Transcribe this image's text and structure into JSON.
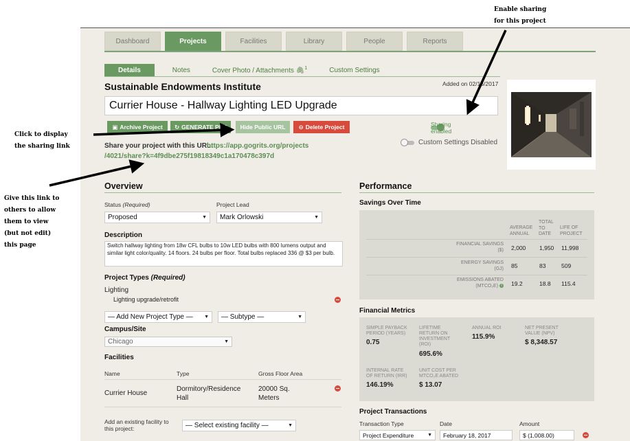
{
  "annotations": {
    "enable_sharing": [
      "Enable sharing",
      "for this project"
    ],
    "click_to_display": [
      "Click to display",
      "the sharing link"
    ],
    "give_link": [
      "Give this link to",
      "others to allow",
      "them to view",
      "(but not edit)",
      "this page"
    ]
  },
  "nav": {
    "tabs": [
      "Dashboard",
      "Projects",
      "Facilities",
      "Library",
      "People",
      "Reports"
    ],
    "active": "Projects"
  },
  "subtabs": {
    "details": "Details",
    "notes": "Notes",
    "cover": "Cover Photo / Attachments",
    "cover_count": "1",
    "custom": "Custom Settings"
  },
  "project": {
    "added": "Added on 02/16/2017",
    "organization": "Sustainable Endowments Institute",
    "title": "Currier House - Hallway Lighting LED Upgrade"
  },
  "buttons": {
    "archive": "Archive Project",
    "generate": "GENERATE PDF",
    "hide_url": "Hide Public URL",
    "delete": "Delete Project"
  },
  "toggles": {
    "sharing": "Sharing enabled",
    "sharing_on": true,
    "custom": "Custom Settings Disabled",
    "custom_on": false
  },
  "share": {
    "label": "Share your project with this URL:",
    "url_part1": "https://app.gogrits.org/projects",
    "url_part2": "/4021/share?k=4f9dbe275f19818349c1a170478c397d"
  },
  "overview": {
    "heading": "Overview",
    "status_label": "Status",
    "required": "(Required)",
    "status_value": "Proposed",
    "lead_label": "Project Lead",
    "lead_value": "Mark Orlowski",
    "description_label": "Description",
    "description": "Switch hallway lighting from 18w CFL bulbs to 10w LED bulbs with 800 lumens output and similar light color/quality. 14 floors. 24 bulbs per floor. Total bulbs replaced 336 @ $3 per bulb.",
    "types_label": "Project Types",
    "types_required": "(Required)",
    "type_name": "Lighting",
    "type_sub": "Lighting upgrade/retrofit",
    "add_type": "— Add New Project Type —",
    "subtype": "— Subtype —",
    "campus_label": "Campus/Site",
    "campus_value": "Chicago",
    "facilities_label": "Facilities",
    "fac_headers": [
      "Name",
      "Type",
      "Gross Floor Area"
    ],
    "fac_row": {
      "name": "Currier House",
      "type": [
        "Dormitory/Residence",
        "Hall"
      ],
      "area": [
        "20000 Sq.",
        "Meters"
      ]
    },
    "existing_label": [
      "Add an existing facility to",
      "this project:"
    ],
    "existing_select": "— Select existing facility —"
  },
  "performance": {
    "heading": "Performance",
    "savings_heading": "Savings Over Time",
    "columns": [
      [
        "AVERAGE",
        "ANNUAL"
      ],
      [
        "TOTAL",
        "TO",
        "DATE"
      ],
      [
        "LIFE OF",
        "PROJECT"
      ]
    ],
    "rows": [
      {
        "label": [
          "FINANCIAL SAVINGS",
          "($)"
        ],
        "values": [
          "2,000",
          "1,950",
          "11,998"
        ]
      },
      {
        "label": [
          "ENERGY SAVINGS",
          "(GJ)"
        ],
        "values": [
          "85",
          "83",
          "509"
        ]
      },
      {
        "label": [
          "EMISSIONS ABATED",
          "(MTCO₂E)"
        ],
        "values": [
          "19.2",
          "18.8",
          "115.4"
        ]
      }
    ],
    "info_icon": "i",
    "financial_heading": "Financial Metrics",
    "metrics": [
      {
        "label": [
          "SIMPLE PAYBACK",
          "PERIOD (YEARS)"
        ],
        "value": "0.75"
      },
      {
        "label": [
          "LIFETIME",
          "RETURN ON",
          "INVESTMENT",
          "(ROI)"
        ],
        "value": "695.6%"
      },
      {
        "label": [
          "ANNUAL ROI"
        ],
        "value": "115.9%"
      },
      {
        "label": [
          "NET PRESENT",
          "VALUE (NPV)"
        ],
        "value": "$ 8,348.57"
      },
      {
        "label": [
          "INTERNAL RATE",
          "OF RETURN (IRR)"
        ],
        "value": "146.19%"
      },
      {
        "label": [
          "UNIT COST PER",
          "MTCO₂E ABATED"
        ],
        "value": "$ 13.07"
      }
    ],
    "transactions_heading": "Project Transactions",
    "tx_headers": [
      "Transaction Type",
      "Date",
      "Amount"
    ],
    "tx_row": {
      "type": "Project Expenditure",
      "date": "February 18, 2017",
      "amount": "$ (1,008.00)"
    }
  },
  "colors": {
    "accent": "#6a9a62",
    "danger": "#d84a3c",
    "background": "#efede5"
  }
}
